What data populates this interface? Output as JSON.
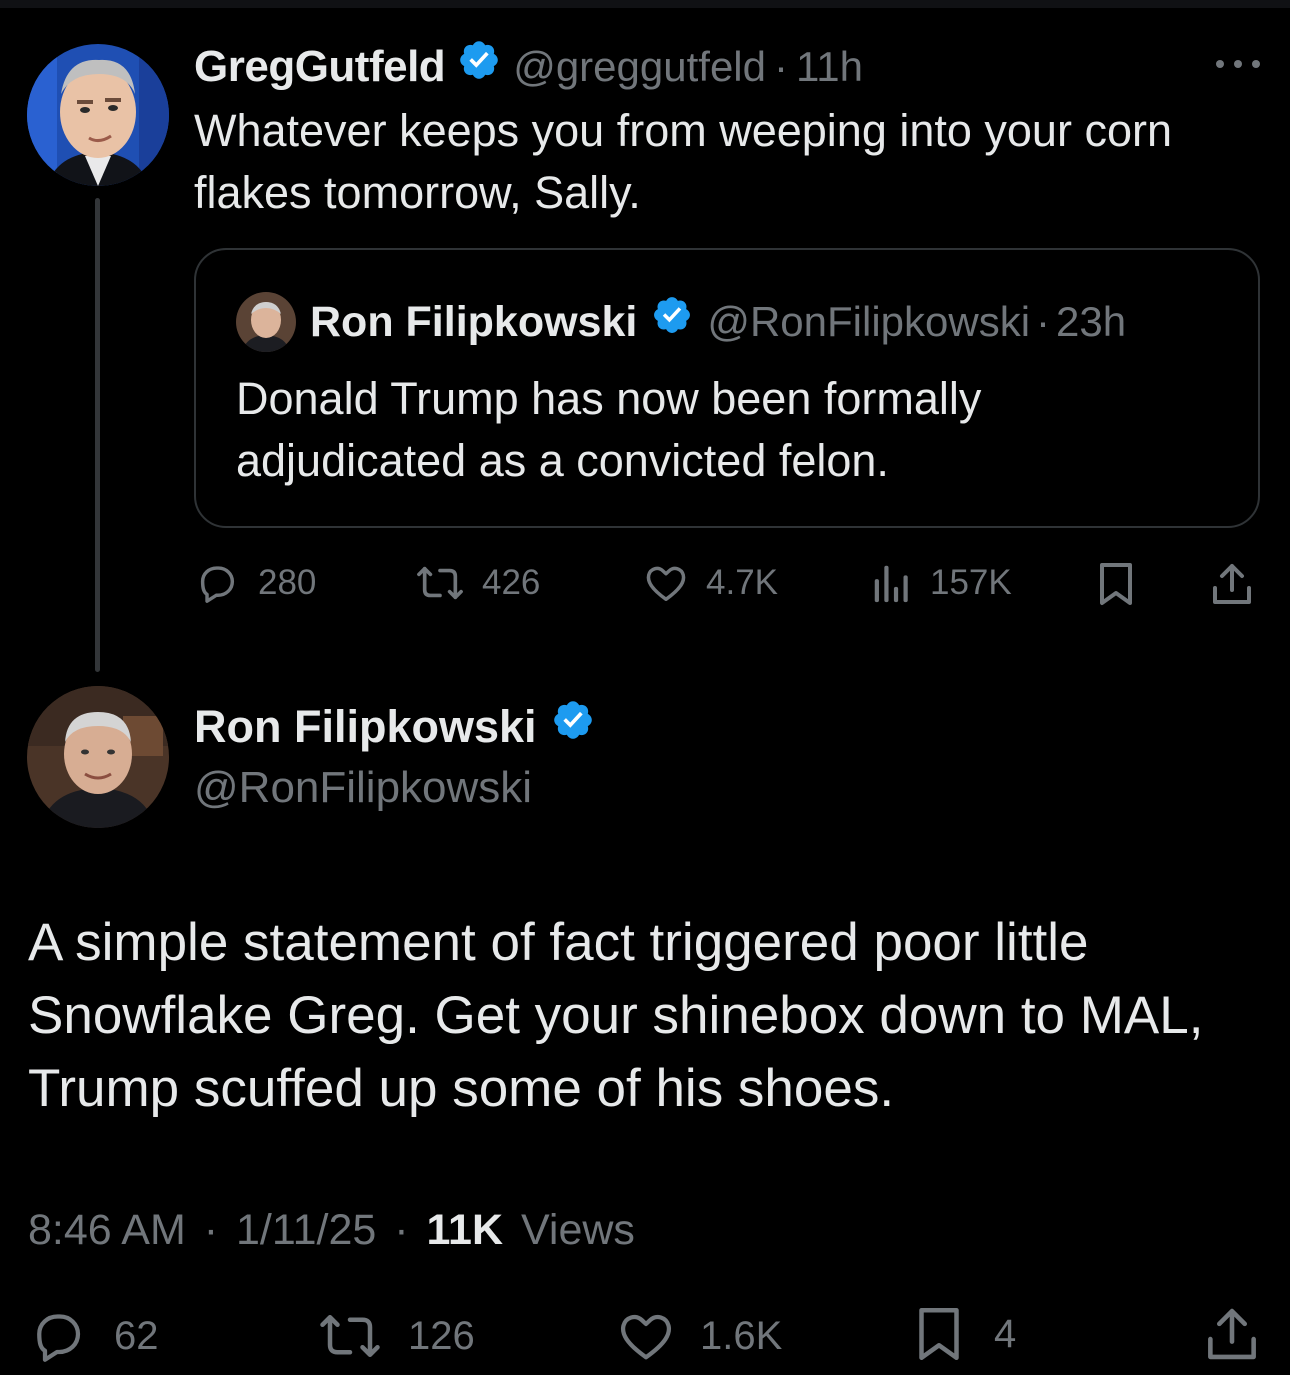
{
  "colors": {
    "background": "#000000",
    "text": "#e7e9ea",
    "muted": "#71767b",
    "verified": "#1d9bf0",
    "border": "#2f3336"
  },
  "parent_tweet": {
    "author_name": "GregGutfeld",
    "author_handle": "@greggutfeld",
    "separator": "·",
    "time": "11h",
    "text": "Whatever keeps you from weeping into your corn flakes tomorrow, Sally.",
    "more_icon": "more-horizontal-icon",
    "quoted": {
      "author_name": "Ron Filipkowski",
      "author_handle": "@RonFilipkowski",
      "separator": "·",
      "time": "23h",
      "text": "Donald Trump has now been formally adjudicated as a convicted felon."
    },
    "stats": {
      "replies": "280",
      "reposts": "426",
      "likes": "4.7K",
      "views": "157K"
    }
  },
  "main_tweet": {
    "author_name": "Ron Filipkowski",
    "author_handle": "@RonFilipkowski",
    "text": "A simple statement of fact triggered poor little Snowflake Greg. Get your shinebox down to MAL, Trump scuffed up some of his shoes.",
    "time": "8:46 AM",
    "date": "1/11/25",
    "separator": "·",
    "views_count": "11K",
    "views_label": "Views",
    "stats": {
      "replies": "62",
      "reposts": "126",
      "likes": "1.6K",
      "bookmarks": "4"
    }
  }
}
